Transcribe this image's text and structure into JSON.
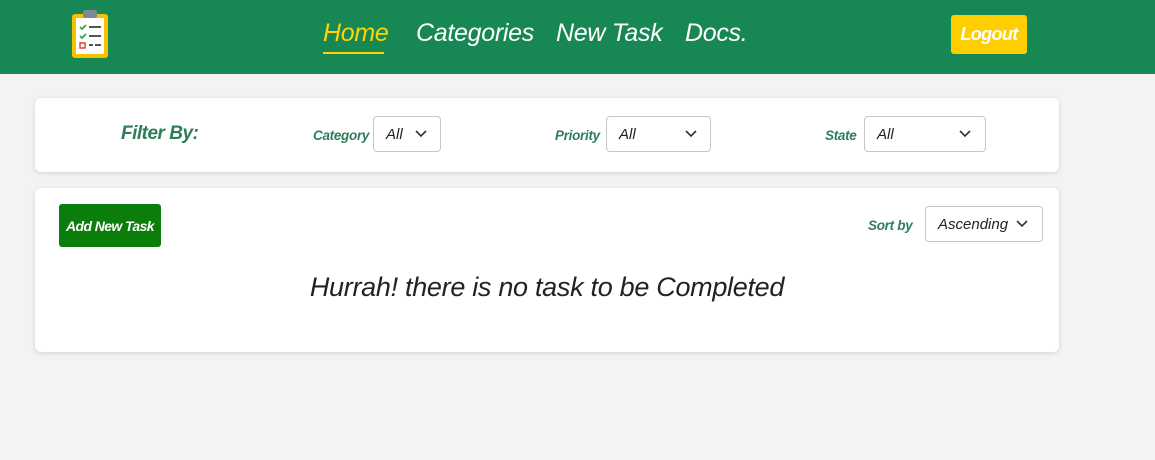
{
  "nav": {
    "links": [
      {
        "label": "Home",
        "active": true
      },
      {
        "label": "Categories",
        "active": false
      },
      {
        "label": "New Task",
        "active": false
      },
      {
        "label": "Docs.",
        "active": false
      }
    ],
    "logout_label": "Logout",
    "logo_icon": "clipboard-checklist-icon"
  },
  "filter": {
    "title": "Filter By:",
    "category": {
      "label": "Category",
      "value": "All"
    },
    "priority": {
      "label": "Priority",
      "value": "All"
    },
    "state": {
      "label": "State",
      "value": "All"
    }
  },
  "tasks": {
    "add_label": "Add New Task",
    "sort_label": "Sort by",
    "sort_value": "Ascending",
    "empty_message": "Hurrah! there is no task to be Completed"
  },
  "colors": {
    "navbar": "#178854",
    "accent": "#ffd400",
    "logout": "#ffce00",
    "add_button": "#0b7d0b",
    "label_green": "#2e7d5b"
  }
}
